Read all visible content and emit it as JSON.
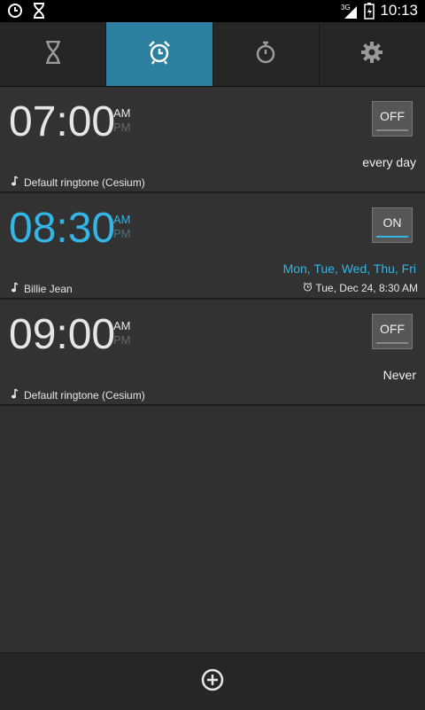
{
  "status_bar": {
    "time": "10:13",
    "network": "3G",
    "icons": [
      "clock-icon",
      "hourglass-icon",
      "signal-icon",
      "battery-icon"
    ]
  },
  "tabs": [
    {
      "name": "timer",
      "icon": "hourglass-icon",
      "active": false
    },
    {
      "name": "alarm",
      "icon": "alarm-clock-icon",
      "active": true
    },
    {
      "name": "stopwatch",
      "icon": "stopwatch-icon",
      "active": false
    },
    {
      "name": "settings",
      "icon": "gear-icon",
      "active": false
    }
  ],
  "alarms": [
    {
      "time": "07:00",
      "am": "AM",
      "pm": "PM",
      "toggle": "OFF",
      "enabled": false,
      "repeat": "every day",
      "ringtone": "Default ringtone (Cesium)",
      "next": ""
    },
    {
      "time": "08:30",
      "am": "AM",
      "pm": "PM",
      "toggle": "ON",
      "enabled": true,
      "repeat": "Mon, Tue, Wed, Thu, Fri",
      "ringtone": "Billie Jean",
      "next": "Tue, Dec 24, 8:30 AM"
    },
    {
      "time": "09:00",
      "am": "AM",
      "pm": "PM",
      "toggle": "OFF",
      "enabled": false,
      "repeat": "Never",
      "ringtone": "Default ringtone (Cesium)",
      "next": ""
    }
  ],
  "colors": {
    "accent": "#33b5e5",
    "active_tab": "#2d7fa0",
    "background": "#303030"
  },
  "bottom_bar": {
    "add_icon": "add-circle-icon"
  }
}
